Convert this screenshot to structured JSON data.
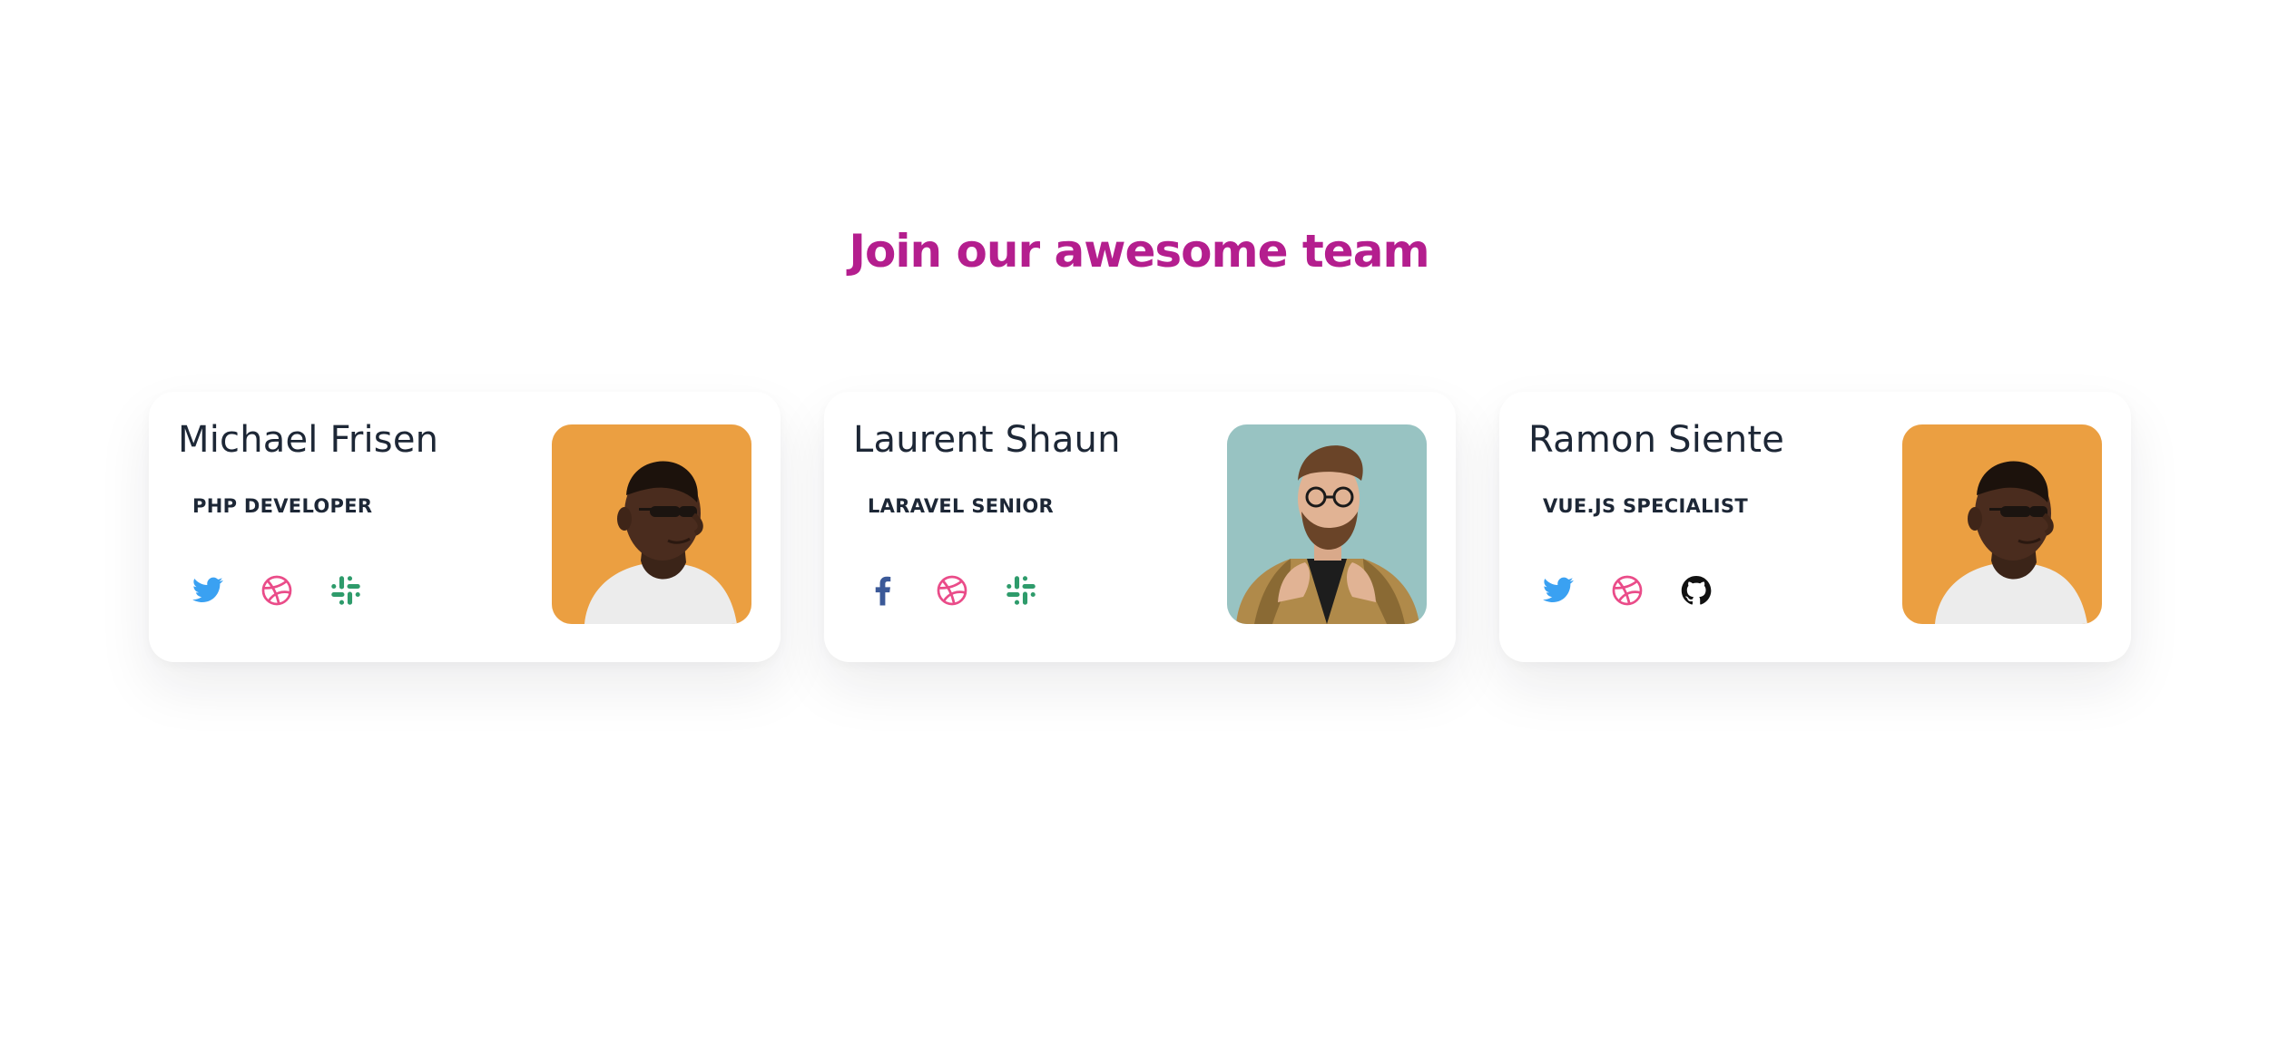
{
  "section": {
    "title": "Join our awesome team"
  },
  "colors": {
    "title": "#b41e8e",
    "twitter": "#3aa1f2",
    "dribbble": "#ea4c89",
    "slack": "#2e9b6b",
    "facebook": "#3b5998",
    "github": "#111111"
  },
  "team": [
    {
      "name": "Michael Frisen",
      "role": "PHP DEVELOPER",
      "social": [
        "twitter-icon",
        "dribbble-icon",
        "slack-icon"
      ],
      "photo": "man-in-sunglasses-orange-background"
    },
    {
      "name": "Laurent Shaun",
      "role": "LARAVEL SENIOR",
      "social": [
        "facebook-icon",
        "dribbble-icon",
        "slack-icon"
      ],
      "photo": "bearded-man-in-glasses-teal-background"
    },
    {
      "name": "Ramon Siente",
      "role": "VUE.JS SPECIALIST",
      "social": [
        "twitter-icon",
        "dribbble-icon",
        "github-icon"
      ],
      "photo": "man-in-sunglasses-orange-background"
    }
  ]
}
